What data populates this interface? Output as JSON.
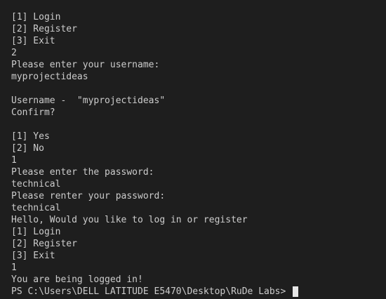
{
  "terminal": {
    "lines": [
      "[1] Login",
      "[2] Register",
      "[3] Exit",
      "2",
      "Please enter your username:",
      "myprojectideas",
      "",
      "Username -  \"myprojectideas\"",
      "Confirm?",
      "",
      "[1] Yes",
      "[2] No",
      "1",
      "Please enter the password:",
      "technical",
      "Please renter your password:",
      "technical",
      "Hello, Would you like to log in or register",
      "[1] Login",
      "[2] Register",
      "[3] Exit",
      "1",
      "You are being logged in!"
    ],
    "prompt": "PS C:\\Users\\DELL LATITUDE E5470\\Desktop\\RuDe Labs> "
  },
  "colors": {
    "background": "#1e1e1e",
    "text": "#cccccc",
    "cursor": "#e6e6e6"
  }
}
